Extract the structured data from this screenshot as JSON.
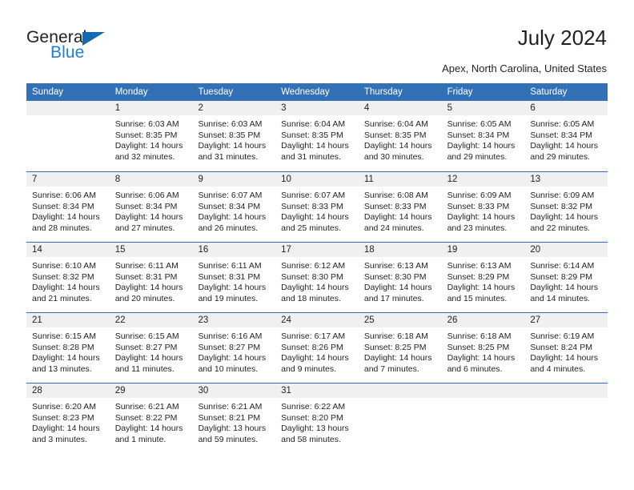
{
  "brand": {
    "name_part1": "General",
    "name_part2": "Blue",
    "accent_color": "#1668b3",
    "blue_text_color": "#1c7fd4"
  },
  "header": {
    "title": "July 2024",
    "location": "Apex, North Carolina, United States"
  },
  "calendar": {
    "header_bg": "#3371b7",
    "daynum_bg": "#f0f0f0",
    "week_divider_color": "#2f6db5",
    "weekdays": [
      "Sunday",
      "Monday",
      "Tuesday",
      "Wednesday",
      "Thursday",
      "Friday",
      "Saturday"
    ],
    "weeks": [
      [
        {
          "day": "",
          "empty": true,
          "sunrise": "",
          "sunset": "",
          "daylight": ""
        },
        {
          "day": "1",
          "sunrise": "Sunrise: 6:03 AM",
          "sunset": "Sunset: 8:35 PM",
          "daylight": "Daylight: 14 hours and 32 minutes."
        },
        {
          "day": "2",
          "sunrise": "Sunrise: 6:03 AM",
          "sunset": "Sunset: 8:35 PM",
          "daylight": "Daylight: 14 hours and 31 minutes."
        },
        {
          "day": "3",
          "sunrise": "Sunrise: 6:04 AM",
          "sunset": "Sunset: 8:35 PM",
          "daylight": "Daylight: 14 hours and 31 minutes."
        },
        {
          "day": "4",
          "sunrise": "Sunrise: 6:04 AM",
          "sunset": "Sunset: 8:35 PM",
          "daylight": "Daylight: 14 hours and 30 minutes."
        },
        {
          "day": "5",
          "sunrise": "Sunrise: 6:05 AM",
          "sunset": "Sunset: 8:34 PM",
          "daylight": "Daylight: 14 hours and 29 minutes."
        },
        {
          "day": "6",
          "sunrise": "Sunrise: 6:05 AM",
          "sunset": "Sunset: 8:34 PM",
          "daylight": "Daylight: 14 hours and 29 minutes."
        }
      ],
      [
        {
          "day": "7",
          "sunrise": "Sunrise: 6:06 AM",
          "sunset": "Sunset: 8:34 PM",
          "daylight": "Daylight: 14 hours and 28 minutes."
        },
        {
          "day": "8",
          "sunrise": "Sunrise: 6:06 AM",
          "sunset": "Sunset: 8:34 PM",
          "daylight": "Daylight: 14 hours and 27 minutes."
        },
        {
          "day": "9",
          "sunrise": "Sunrise: 6:07 AM",
          "sunset": "Sunset: 8:34 PM",
          "daylight": "Daylight: 14 hours and 26 minutes."
        },
        {
          "day": "10",
          "sunrise": "Sunrise: 6:07 AM",
          "sunset": "Sunset: 8:33 PM",
          "daylight": "Daylight: 14 hours and 25 minutes."
        },
        {
          "day": "11",
          "sunrise": "Sunrise: 6:08 AM",
          "sunset": "Sunset: 8:33 PM",
          "daylight": "Daylight: 14 hours and 24 minutes."
        },
        {
          "day": "12",
          "sunrise": "Sunrise: 6:09 AM",
          "sunset": "Sunset: 8:33 PM",
          "daylight": "Daylight: 14 hours and 23 minutes."
        },
        {
          "day": "13",
          "sunrise": "Sunrise: 6:09 AM",
          "sunset": "Sunset: 8:32 PM",
          "daylight": "Daylight: 14 hours and 22 minutes."
        }
      ],
      [
        {
          "day": "14",
          "sunrise": "Sunrise: 6:10 AM",
          "sunset": "Sunset: 8:32 PM",
          "daylight": "Daylight: 14 hours and 21 minutes."
        },
        {
          "day": "15",
          "sunrise": "Sunrise: 6:11 AM",
          "sunset": "Sunset: 8:31 PM",
          "daylight": "Daylight: 14 hours and 20 minutes."
        },
        {
          "day": "16",
          "sunrise": "Sunrise: 6:11 AM",
          "sunset": "Sunset: 8:31 PM",
          "daylight": "Daylight: 14 hours and 19 minutes."
        },
        {
          "day": "17",
          "sunrise": "Sunrise: 6:12 AM",
          "sunset": "Sunset: 8:30 PM",
          "daylight": "Daylight: 14 hours and 18 minutes."
        },
        {
          "day": "18",
          "sunrise": "Sunrise: 6:13 AM",
          "sunset": "Sunset: 8:30 PM",
          "daylight": "Daylight: 14 hours and 17 minutes."
        },
        {
          "day": "19",
          "sunrise": "Sunrise: 6:13 AM",
          "sunset": "Sunset: 8:29 PM",
          "daylight": "Daylight: 14 hours and 15 minutes."
        },
        {
          "day": "20",
          "sunrise": "Sunrise: 6:14 AM",
          "sunset": "Sunset: 8:29 PM",
          "daylight": "Daylight: 14 hours and 14 minutes."
        }
      ],
      [
        {
          "day": "21",
          "sunrise": "Sunrise: 6:15 AM",
          "sunset": "Sunset: 8:28 PM",
          "daylight": "Daylight: 14 hours and 13 minutes."
        },
        {
          "day": "22",
          "sunrise": "Sunrise: 6:15 AM",
          "sunset": "Sunset: 8:27 PM",
          "daylight": "Daylight: 14 hours and 11 minutes."
        },
        {
          "day": "23",
          "sunrise": "Sunrise: 6:16 AM",
          "sunset": "Sunset: 8:27 PM",
          "daylight": "Daylight: 14 hours and 10 minutes."
        },
        {
          "day": "24",
          "sunrise": "Sunrise: 6:17 AM",
          "sunset": "Sunset: 8:26 PM",
          "daylight": "Daylight: 14 hours and 9 minutes."
        },
        {
          "day": "25",
          "sunrise": "Sunrise: 6:18 AM",
          "sunset": "Sunset: 8:25 PM",
          "daylight": "Daylight: 14 hours and 7 minutes."
        },
        {
          "day": "26",
          "sunrise": "Sunrise: 6:18 AM",
          "sunset": "Sunset: 8:25 PM",
          "daylight": "Daylight: 14 hours and 6 minutes."
        },
        {
          "day": "27",
          "sunrise": "Sunrise: 6:19 AM",
          "sunset": "Sunset: 8:24 PM",
          "daylight": "Daylight: 14 hours and 4 minutes."
        }
      ],
      [
        {
          "day": "28",
          "sunrise": "Sunrise: 6:20 AM",
          "sunset": "Sunset: 8:23 PM",
          "daylight": "Daylight: 14 hours and 3 minutes."
        },
        {
          "day": "29",
          "sunrise": "Sunrise: 6:21 AM",
          "sunset": "Sunset: 8:22 PM",
          "daylight": "Daylight: 14 hours and 1 minute."
        },
        {
          "day": "30",
          "sunrise": "Sunrise: 6:21 AM",
          "sunset": "Sunset: 8:21 PM",
          "daylight": "Daylight: 13 hours and 59 minutes."
        },
        {
          "day": "31",
          "sunrise": "Sunrise: 6:22 AM",
          "sunset": "Sunset: 8:20 PM",
          "daylight": "Daylight: 13 hours and 58 minutes."
        },
        {
          "day": "",
          "empty": true,
          "sunrise": "",
          "sunset": "",
          "daylight": ""
        },
        {
          "day": "",
          "empty": true,
          "sunrise": "",
          "sunset": "",
          "daylight": ""
        },
        {
          "day": "",
          "empty": true,
          "sunrise": "",
          "sunset": "",
          "daylight": ""
        }
      ]
    ]
  }
}
